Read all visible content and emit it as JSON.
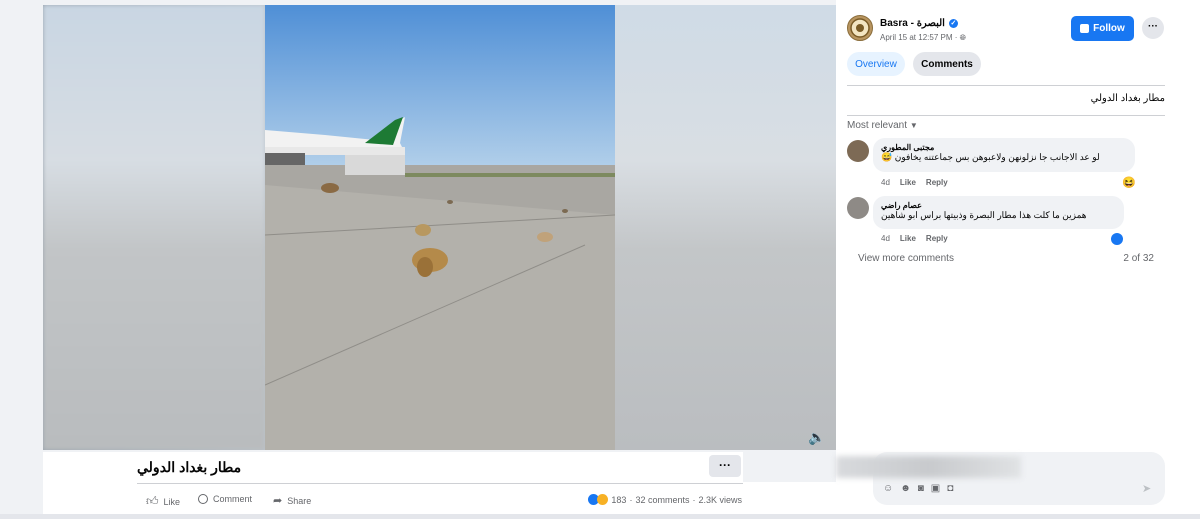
{
  "post": {
    "title": "مطار بغداد الدولي",
    "more_label": "···",
    "actions": {
      "like": "Like",
      "comment": "Comment",
      "share": "Share"
    },
    "stats": {
      "reactions": "183",
      "comments": "32 comments",
      "views": "2.3K views"
    }
  },
  "sidebar": {
    "page_name": "Basra - البصرة",
    "date": "April 15 at 12:57 PM · ",
    "follow_label": "Follow",
    "more_label": "···",
    "tabs": [
      {
        "label": "Overview"
      },
      {
        "label": "Comments"
      }
    ],
    "caption": "مطار بغداد الدولي",
    "sort_label": "Most relevant",
    "comments": [
      {
        "author": "مجتبى المطوري",
        "text": "لو عد الاجانب جا نزلونهن ولاعبوهن بس جماعتنه يخافون 😅",
        "time": "4d",
        "like": "Like",
        "reply": "Reply"
      },
      {
        "author": "عصام راضي",
        "text": "همزين ما كلت هذا مطار البصرة وذبيتها براس ابو شاهين",
        "time": "4d",
        "like": "Like",
        "reply": "Reply"
      }
    ],
    "view_more": "View more comments",
    "count": "2 of 32"
  },
  "colors": {
    "accent": "#1877f2",
    "bg": "#f0f2f5"
  }
}
